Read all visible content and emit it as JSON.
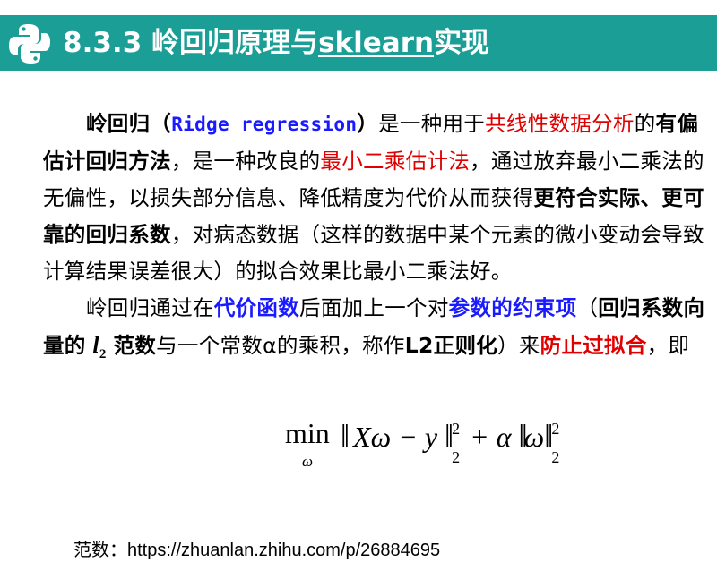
{
  "header": {
    "title_prefix": "8.3.3  岭回归原理与",
    "title_underlined": "sklearn",
    "title_suffix": "实现",
    "logo_icon": "python-logo-icon",
    "background_color": "#1a9e96"
  },
  "paragraph1": {
    "s1": "岭回归（",
    "s2": "Ridge regression",
    "s3": "）",
    "s4": "是一种用于",
    "s5": "共线性数据分析",
    "s6": "的",
    "s7": "有偏估计回归方法",
    "s8": "，是一种改良的",
    "s9": "最小二乘估计法",
    "s10": "，通过放弃最小二乘法的无偏性，以损失部分信息、降低精度为代价从而获得",
    "s11": "更符合实际、更可靠的回归系数",
    "s12": "，对病态数据（这样的数据中某个元素的微小变动会导致计算结果误差很大）的拟合效果比最小二乘法好。"
  },
  "paragraph2": {
    "s1": "岭回归通过在",
    "s2": "代价函数",
    "s3": "后面加上一个对",
    "s4": "参数的约束项",
    "s5": "（",
    "s6": "回归系数向量的",
    "s7": "l",
    "s8": "2",
    "s9": "范数",
    "s10": "与一个常数α的乘积，称作",
    "s11": "L2正则化",
    "s12": "）来",
    "s13": "防止过拟合",
    "s14": "，即"
  },
  "formula": {
    "min": "min",
    "sub": "ω",
    "expr_left": "Xω − y",
    "plus": "+ α",
    "expr_right": "ω",
    "exp": "2",
    "norm": "2"
  },
  "reference": "范数：https://zhuanlan.zhihu.com/p/26884695",
  "colors": {
    "red": "#e00000",
    "blue": "#1a1aff"
  }
}
